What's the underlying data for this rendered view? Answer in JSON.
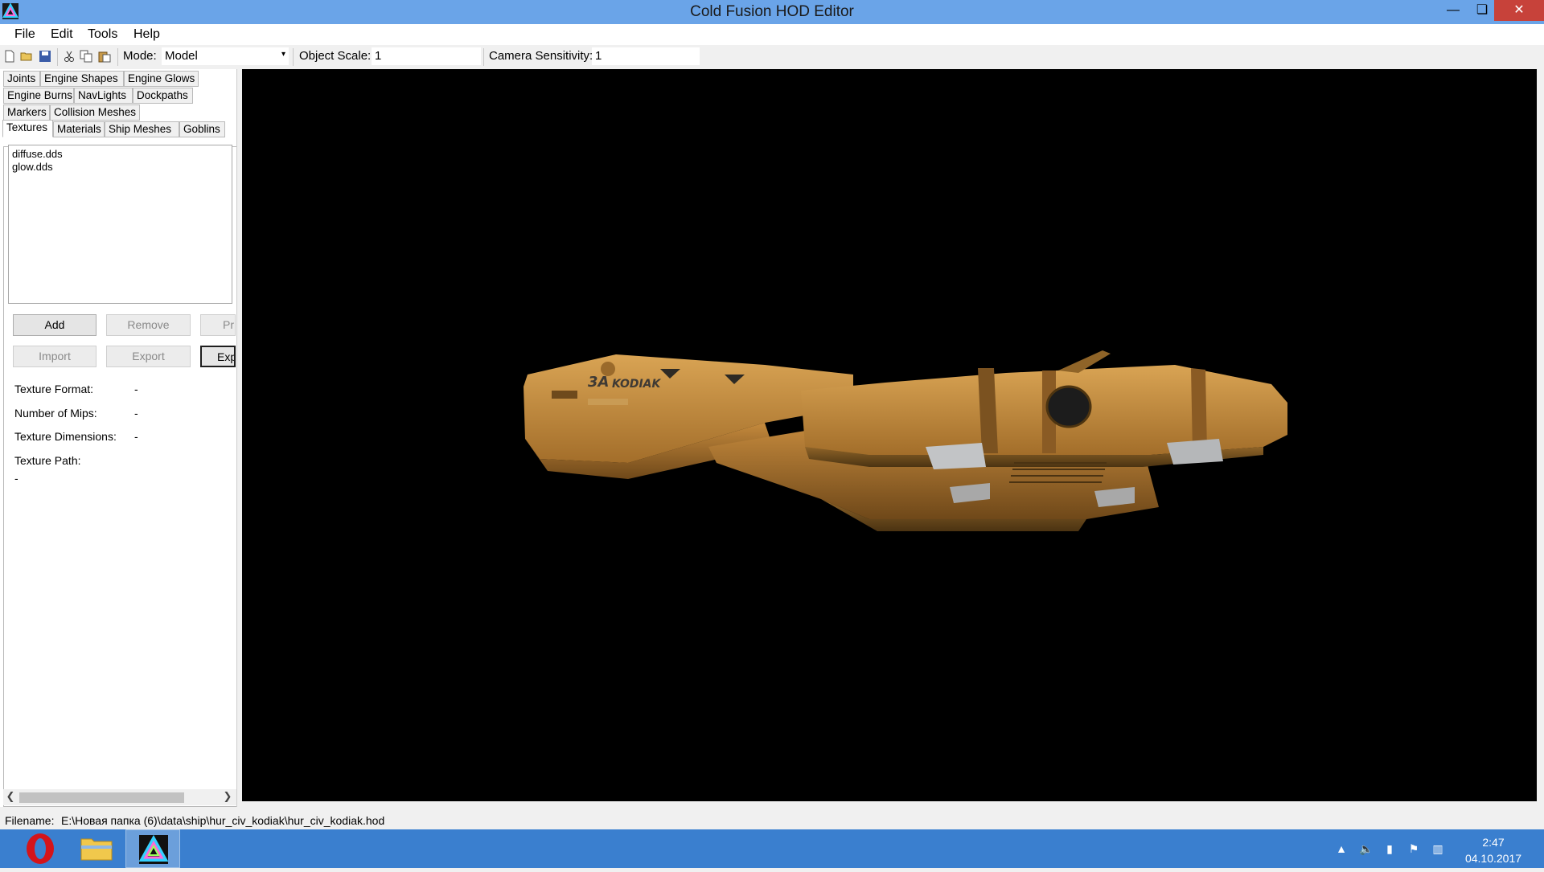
{
  "window": {
    "title": "Cold Fusion HOD Editor"
  },
  "menu": [
    "File",
    "Edit",
    "Tools",
    "Help"
  ],
  "toolbar": {
    "mode_label": "Mode:",
    "mode_value": "Model",
    "scale_label": "Object Scale:",
    "scale_value": "1",
    "camera_label": "Camera Sensitivity:",
    "camera_value": "1"
  },
  "tabs": {
    "row1": [
      "Joints",
      "Engine Shapes",
      "Engine Glows"
    ],
    "row2": [
      "Engine Burns",
      "NavLights",
      "Dockpaths"
    ],
    "row3": [
      "Markers",
      "Collision Meshes"
    ],
    "row4": [
      "Textures",
      "Materials",
      "Ship Meshes",
      "Goblins"
    ],
    "active": "Textures"
  },
  "textures": {
    "items": [
      "diffuse.dds",
      "glow.dds"
    ],
    "buttons": {
      "add": "Add",
      "remove": "Remove",
      "preview": "Pr",
      "import": "Import",
      "export": "Export",
      "export_all": "Exp"
    },
    "props": {
      "format_label": "Texture Format:",
      "format_value": "-",
      "mips_label": "Number of Mips:",
      "mips_value": "-",
      "dims_label": "Texture Dimensions:",
      "dims_value": "-",
      "path_label": "Texture Path:",
      "path_value": "-"
    }
  },
  "status": {
    "filename_label": "Filename:",
    "filename_value": "E:\\Новая папка (6)\\data\\ship\\hur_civ_kodiak\\hur_civ_kodiak.hod"
  },
  "viewport": {
    "model_markings": [
      "3A",
      "KODIAK"
    ]
  },
  "taskbar": {
    "apps": [
      "opera-browser",
      "file-explorer",
      "cold-fusion-hod-editor"
    ],
    "time": "2:47",
    "date": "04.10.2017"
  }
}
